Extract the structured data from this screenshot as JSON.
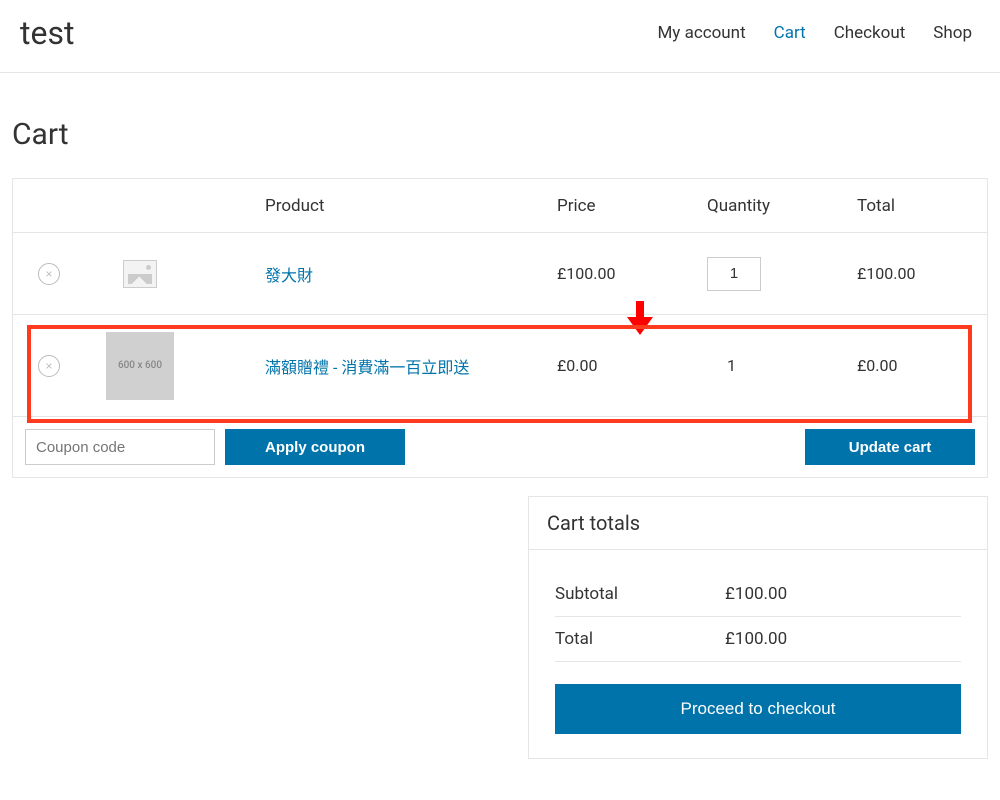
{
  "site": {
    "title": "test"
  },
  "nav": {
    "my_account": "My account",
    "cart": "Cart",
    "checkout": "Checkout",
    "shop": "Shop"
  },
  "page": {
    "title": "Cart"
  },
  "table": {
    "headers": {
      "product": "Product",
      "price": "Price",
      "quantity": "Quantity",
      "total": "Total"
    },
    "rows": [
      {
        "remove_icon": "×",
        "thumb_label": "",
        "product_name": "發大財",
        "price": "£100.00",
        "quantity": "1",
        "line_total": "£100.00",
        "editable_qty": true
      },
      {
        "remove_icon": "×",
        "thumb_label": "600 x 600",
        "product_name": "滿額贈禮 - 消費滿一百立即送",
        "price": "£0.00",
        "quantity": "1",
        "line_total": "£0.00",
        "editable_qty": false
      }
    ]
  },
  "coupon": {
    "placeholder": "Coupon code",
    "apply_label": "Apply coupon"
  },
  "update_label": "Update cart",
  "totals": {
    "title": "Cart totals",
    "subtotal_label": "Subtotal",
    "subtotal_value": "£100.00",
    "total_label": "Total",
    "total_value": "£100.00",
    "checkout_label": "Proceed to checkout"
  }
}
